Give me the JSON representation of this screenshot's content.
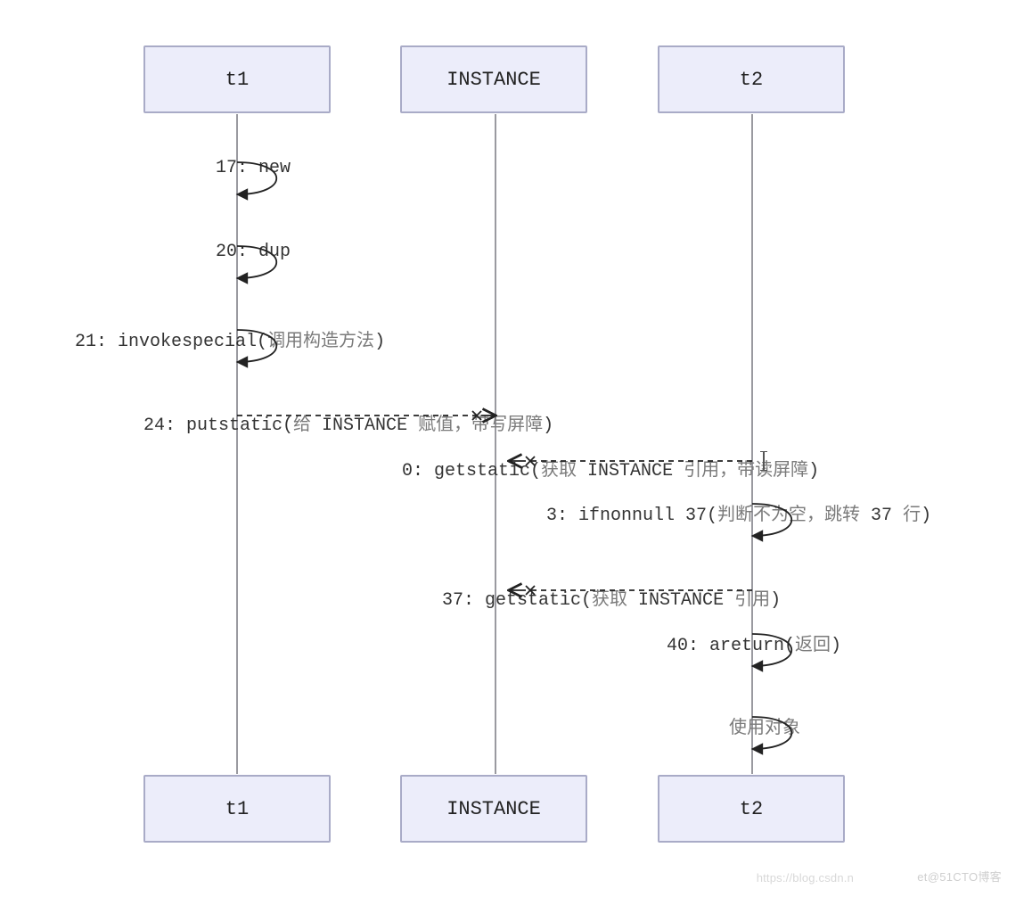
{
  "actors": {
    "t1": "t1",
    "instance": "INSTANCE",
    "t2": "t2"
  },
  "messages": {
    "m1": "17: new",
    "m2": "20: dup",
    "m3_a": "21: invokespecial(",
    "m3_b": "调用构造方法",
    "m3_c": ")",
    "m4_a": "24: putstatic(",
    "m4_b": "给",
    "m4_c": " INSTANCE ",
    "m4_d": "赋值，带写屏障",
    "m4_e": ")",
    "m5_a": "0: getstatic(",
    "m5_b": "获取",
    "m5_c": " INSTANCE ",
    "m5_d": "引用，带读屏障",
    "m5_e": ")",
    "m6_a": "3: ifnonnull 37(",
    "m6_b": "判断不为空，跳转",
    "m6_c": " 37 ",
    "m6_d": "行",
    "m6_e": ")",
    "m7_a": "37: getstatic(",
    "m7_b": "获取",
    "m7_c": " INSTANCE ",
    "m7_d": "引用",
    "m7_e": ")",
    "m8_a": "40: areturn(",
    "m8_b": "返回",
    "m8_c": ")",
    "m9": "使用对象"
  },
  "watermark": {
    "left": "https://blog.csdn.n",
    "right": "et@51CTO博客"
  },
  "chart_data": {
    "type": "sequence-diagram",
    "participants": [
      "t1",
      "INSTANCE",
      "t2"
    ],
    "messages": [
      {
        "from": "t1",
        "to": "t1",
        "text": "17: new",
        "style": "self"
      },
      {
        "from": "t1",
        "to": "t1",
        "text": "20: dup",
        "style": "self"
      },
      {
        "from": "t1",
        "to": "t1",
        "text": "21: invokespecial(调用构造方法)",
        "style": "self"
      },
      {
        "from": "t1",
        "to": "INSTANCE",
        "text": "24: putstatic(给 INSTANCE 赋值，带写屏障)",
        "style": "dashed-lost"
      },
      {
        "from": "t2",
        "to": "INSTANCE",
        "text": "0: getstatic(获取 INSTANCE 引用，带读屏障)",
        "style": "dashed-lost"
      },
      {
        "from": "t2",
        "to": "t2",
        "text": "3: ifnonnull 37(判断不为空，跳转 37 行)",
        "style": "self"
      },
      {
        "from": "t2",
        "to": "INSTANCE",
        "text": "37: getstatic(获取 INSTANCE 引用)",
        "style": "dashed-lost"
      },
      {
        "from": "t2",
        "to": "t2",
        "text": "40: areturn(返回)",
        "style": "self"
      },
      {
        "from": "t2",
        "to": "t2",
        "text": "使用对象",
        "style": "self"
      }
    ]
  }
}
